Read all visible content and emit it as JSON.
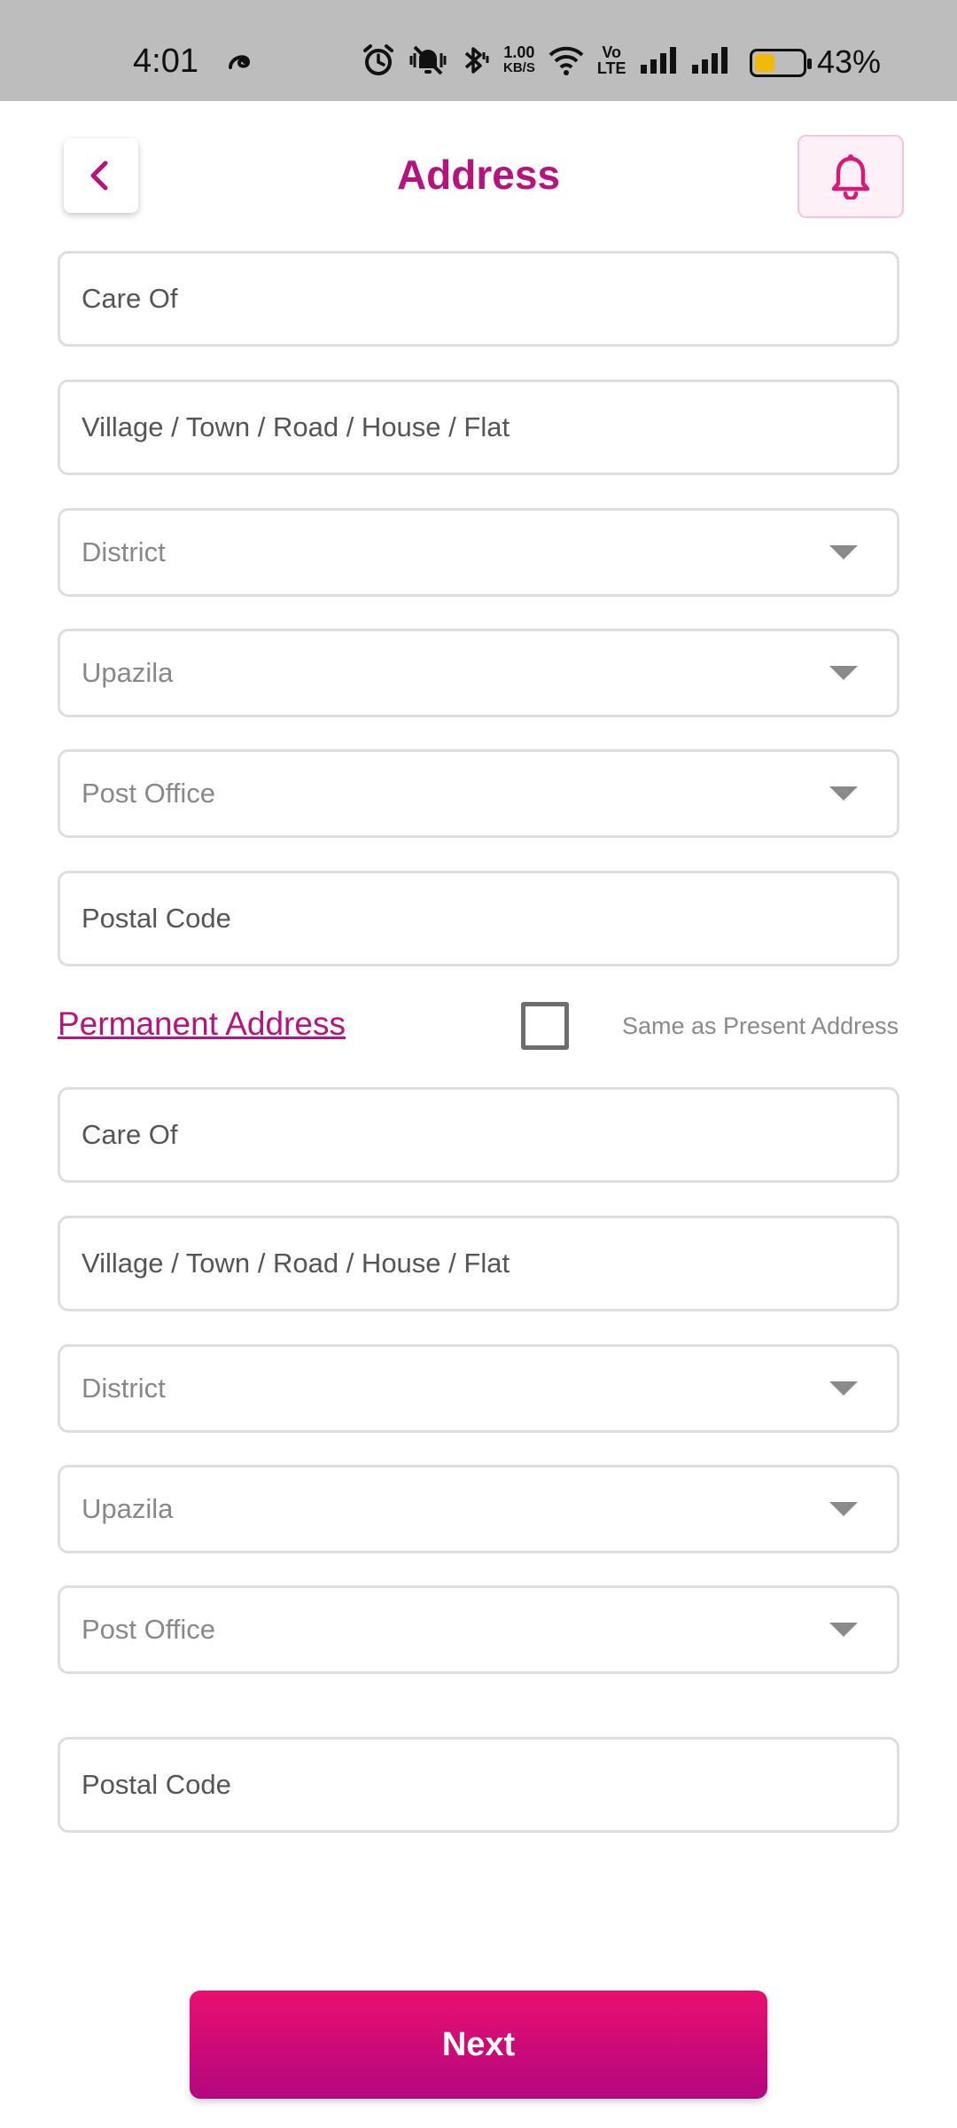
{
  "status_bar": {
    "time": "4:01",
    "speed_value": "1.00",
    "speed_unit": "KB/S",
    "volte_top": "Vo",
    "volte_bottom": "LTE",
    "battery_percent": "43%",
    "battery_level": 0.43,
    "battery_color": "#f0b90b"
  },
  "header": {
    "title": "Address",
    "back_icon": "chevron-left-icon",
    "bell_icon": "bell-icon"
  },
  "present_address": {
    "care_of": "Care Of",
    "village": "Village / Town / Road / House / Flat",
    "district": "District",
    "upazila": "Upazila",
    "post_office": "Post Office",
    "postal_code": "Postal Code"
  },
  "permanent_address": {
    "title": "Permanent Address",
    "same_as_present_label": "Same as Present Address",
    "same_as_present_checked": false,
    "care_of": "Care Of",
    "village": "Village / Town / Road / House / Flat",
    "district": "District",
    "upazila": "Upazila",
    "post_office": "Post Office",
    "postal_code": "Postal Code"
  },
  "footer": {
    "next_label": "Next"
  },
  "colors": {
    "accent": "#b5137e",
    "button_gradient_top": "#e90f6f",
    "button_gradient_bottom": "#b3077f"
  }
}
